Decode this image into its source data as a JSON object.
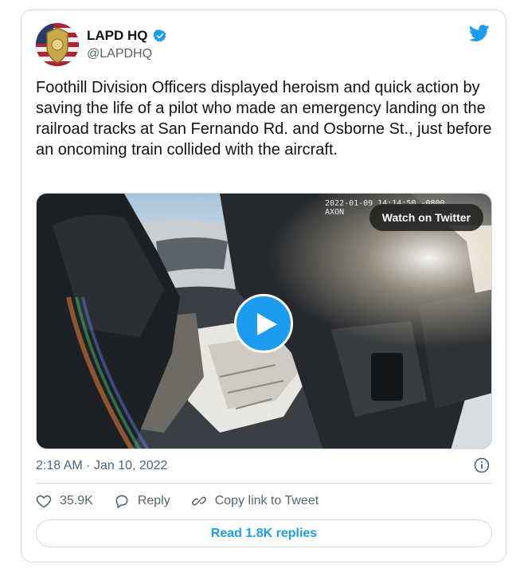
{
  "author": {
    "name": "LAPD HQ",
    "handle": "@LAPDHQ",
    "verified": true
  },
  "tweet": {
    "text": "Foothill Division Officers displayed heroism and quick action by saving the life of a pilot who made an emergency landing on the railroad tracks at San Fernando Rd. and Osborne St., just before an oncoming train collided with the aircraft.",
    "timestamp": "2:18 AM · Jan 10, 2022"
  },
  "media": {
    "bodycam_stamp_line1": "2022-01-09 14:14:50 -0800",
    "bodycam_stamp_line2": "AXON",
    "watch_label": "Watch on Twitter"
  },
  "actions": {
    "likes": "35.9K",
    "reply_label": "Reply",
    "copy_link_label": "Copy link to Tweet"
  },
  "replies_button": "Read 1.8K replies",
  "colors": {
    "accent": "#1d9bf0",
    "text": "#0f1419",
    "secondary": "#536471",
    "border": "#cfd9de"
  }
}
